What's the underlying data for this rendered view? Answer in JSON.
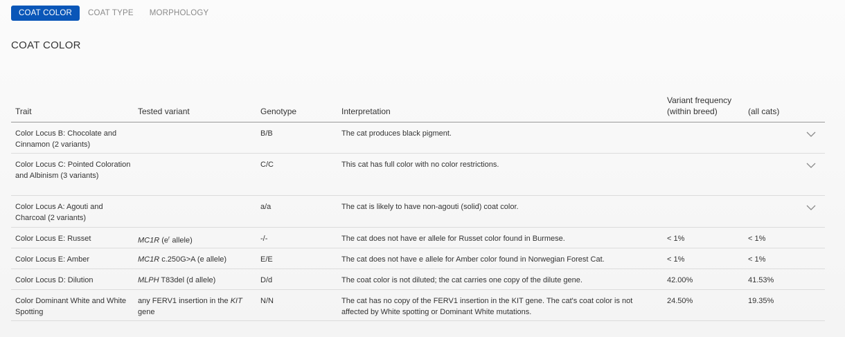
{
  "tabs": [
    {
      "label": "COAT COLOR",
      "active": true
    },
    {
      "label": "COAT TYPE",
      "active": false
    },
    {
      "label": "MORPHOLOGY",
      "active": false
    }
  ],
  "section_title": "COAT COLOR",
  "columns": {
    "trait": "Trait",
    "tested_variant": "Tested variant",
    "genotype": "Genotype",
    "interpretation": "Interpretation",
    "freq_header": "Variant frequency",
    "freq_within": "(within breed)",
    "freq_all": "(all cats)"
  },
  "rows": [
    {
      "trait": "Color Locus B: Chocolate and Cinnamon (2 variants)",
      "variant_gene": "",
      "variant_rest": "",
      "variant_suffix": "",
      "genotype": "B/B",
      "interpretation": "The cat produces black pigment.",
      "freq_within": "",
      "freq_all": "",
      "expandable": true
    },
    {
      "trait": "Color Locus C: Pointed Coloration and Albinism (3 variants)",
      "variant_gene": "",
      "variant_rest": "",
      "variant_suffix": "",
      "genotype": "C/C",
      "interpretation": "This cat has full color with no color restrictions.",
      "freq_within": "",
      "freq_all": "",
      "expandable": true
    },
    {
      "trait": "Color Locus A: Agouti and Charcoal (2 variants)",
      "variant_gene": "",
      "variant_rest": "",
      "variant_suffix": "",
      "genotype": "a/a",
      "interpretation": "The cat is likely to have non-agouti (solid) coat color.",
      "freq_within": "",
      "freq_all": "",
      "expandable": true
    },
    {
      "trait": "Color Locus E: Russet",
      "variant_gene": "MC1R",
      "variant_rest": " (e",
      "variant_sup": "r",
      "variant_suffix": " allele)",
      "genotype": "-/-",
      "interpretation": "The cat does not have er allele for Russet color found in Burmese.",
      "freq_within": "< 1%",
      "freq_all": "< 1%",
      "expandable": false
    },
    {
      "trait": "Color Locus E: Amber",
      "variant_gene": "MC1R",
      "variant_rest": " c.250G>A (e allele)",
      "variant_sup": "",
      "variant_suffix": "",
      "genotype": "E/E",
      "interpretation": "The cat does not have e allele for Amber color found in Norwegian Forest Cat.",
      "freq_within": "< 1%",
      "freq_all": "< 1%",
      "expandable": false
    },
    {
      "trait": "Color Locus D: Dilution",
      "variant_gene": "MLPH",
      "variant_rest": " T83del (d allele)",
      "variant_sup": "",
      "variant_suffix": "",
      "genotype": "D/d",
      "interpretation": "The coat color is not diluted; the cat carries one copy of the dilute gene.",
      "freq_within": "42.00%",
      "freq_all": "41.53%",
      "expandable": false
    },
    {
      "trait": "Color Dominant White and White Spotting",
      "variant_pre": "any FERV1 insertion in the ",
      "variant_gene2": "KIT",
      "variant_post": " gene",
      "genotype": "N/N",
      "interpretation": "The cat has no copy of the FERV1 insertion in the KIT gene. The cat's coat color is not affected by White spotting or Dominant White mutations.",
      "freq_within": "24.50%",
      "freq_all": "19.35%",
      "expandable": false
    }
  ],
  "colors": {
    "accent": "#0a56b8"
  },
  "icons": {
    "expand": "chevron-down-icon"
  }
}
